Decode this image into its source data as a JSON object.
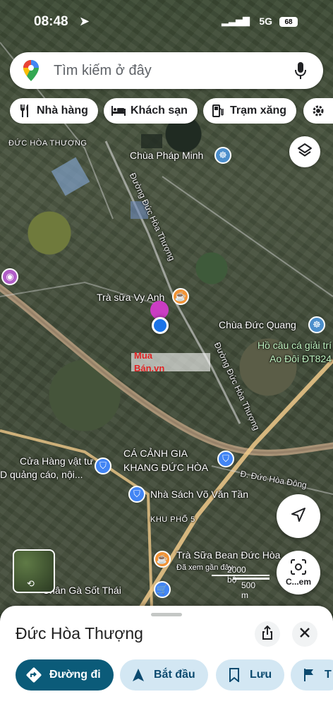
{
  "status_bar": {
    "time": "08:48",
    "network": "5G",
    "battery": "68"
  },
  "search": {
    "placeholder": "Tìm kiếm ở đây"
  },
  "chips": [
    {
      "label": "Nhà hàng",
      "icon": "utensils-icon"
    },
    {
      "label": "Khách sạn",
      "icon": "bed-icon"
    },
    {
      "label": "Trạm xăng",
      "icon": "gas-pump-icon"
    }
  ],
  "map_labels": {
    "duc_hoa_thuong_area": "ĐỨC HÒA THƯỢNG",
    "chua_phap_minh": "Chùa Pháp Minh",
    "duong_duc_hoa_thuong_1": "Đường Đức Hòa Thượng",
    "duong_duc_hoa_thuong_2": "Đường Đức Hòa Thượng",
    "tra_sua_vy_anh": "Trà sữa Vy Anh",
    "chua_duc_quang": "Chùa Đức Quang",
    "ho_cau": "Hồ câu cá giải trí",
    "ao_doi": "Ao Đôi ĐT824",
    "cua_hang_vat_tu": "Cửa Hàng vật tư",
    "d_quang_cao": "D quảng cáo, nội...",
    "ca_canh_gia": "CÁ CẢNH GIA",
    "khang_duc_hoa": "KHANG ĐỨC HÒA",
    "d_duc_hoa_dong": "Đ. Đức Hòa Đông",
    "nha_sach": "Nhà Sách Võ Văn Tần",
    "khu_pho_5": "KHU PHỐ 5",
    "tra_sua_bean": "Trà Sữa Bean Đức Hòa",
    "da_xem_gan_day": "Đã xem gần đây",
    "chan_ga": "Chân Gà Sốt Thái"
  },
  "watermark": {
    "line1": "Mua",
    "line2": "Bán.vn"
  },
  "scale": {
    "feet": "2000 bộ",
    "meters": "500 m"
  },
  "lens_button": {
    "label": "C...em"
  },
  "place": {
    "title": "Đức Hòa Thượng"
  },
  "actions": [
    {
      "label": "Đường đi",
      "icon": "directions-icon"
    },
    {
      "label": "Bắt đầu",
      "icon": "navigation-arrow-icon"
    },
    {
      "label": "Lưu",
      "icon": "bookmark-icon"
    },
    {
      "label": "T",
      "icon": "flag-icon"
    }
  ],
  "colors": {
    "primary": "#0b5b79",
    "tonal": "#d3e7f3",
    "location_dot": "#1a73e8",
    "pin": "#d93bd1",
    "poi_orange": "#f29336",
    "poi_blue": "#4285f4"
  }
}
